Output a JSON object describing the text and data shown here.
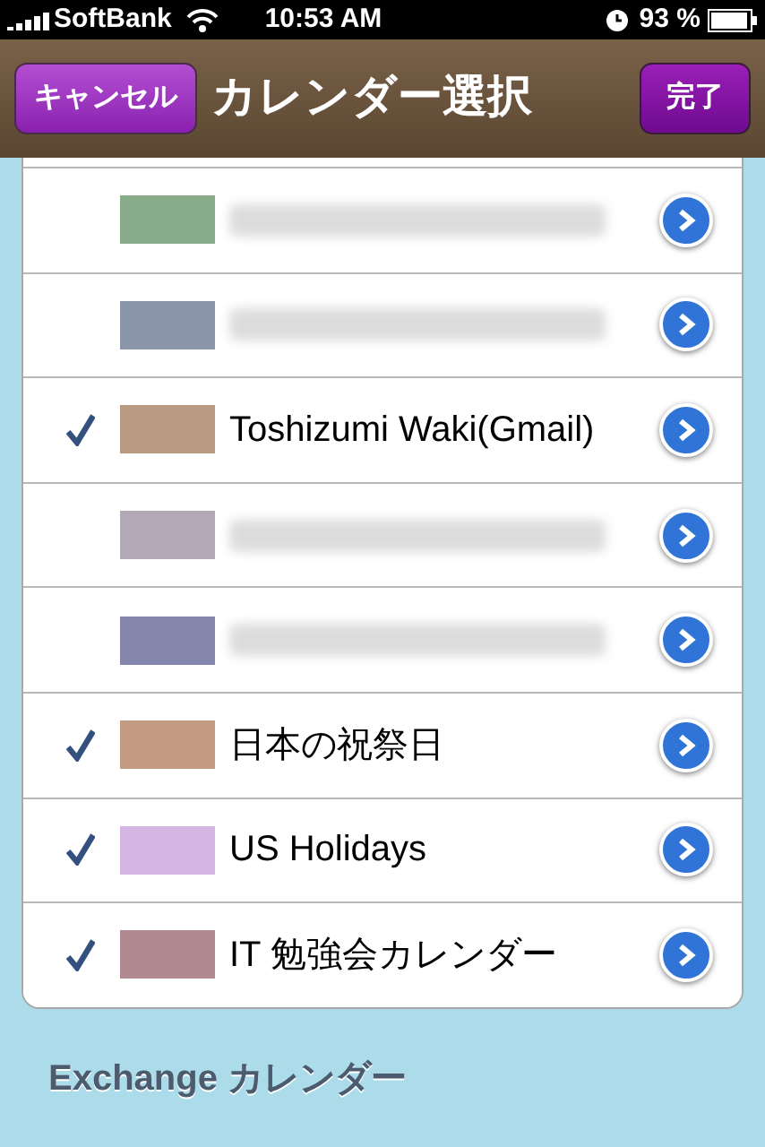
{
  "status_bar": {
    "carrier": "SoftBank",
    "time": "10:53 AM",
    "battery": "93 %"
  },
  "nav_bar": {
    "cancel": "キャンセル",
    "title": "カレンダー選択",
    "done": "完了"
  },
  "calendars": [
    {
      "kind": "blurred",
      "checked": false,
      "color": "#88ab89"
    },
    {
      "kind": "blurred",
      "checked": false,
      "color": "#8a95aa"
    },
    {
      "kind": "named",
      "name": "Toshizumi Waki(Gmail)",
      "checked": true,
      "color": "#b89a80"
    },
    {
      "kind": "blurred",
      "checked": false,
      "color": "#b3a8b6"
    },
    {
      "kind": "blurred",
      "checked": false,
      "color": "#8385ad"
    },
    {
      "kind": "named",
      "name": "日本の祝祭日",
      "checked": true,
      "color": "#c39a82"
    },
    {
      "kind": "named",
      "name": "US Holidays",
      "checked": true,
      "color": "#d5b6e2"
    },
    {
      "kind": "named",
      "name": "IT 勉強会カレンダー",
      "checked": true,
      "color": "#b08890"
    }
  ],
  "section_header": "Exchange カレンダー"
}
